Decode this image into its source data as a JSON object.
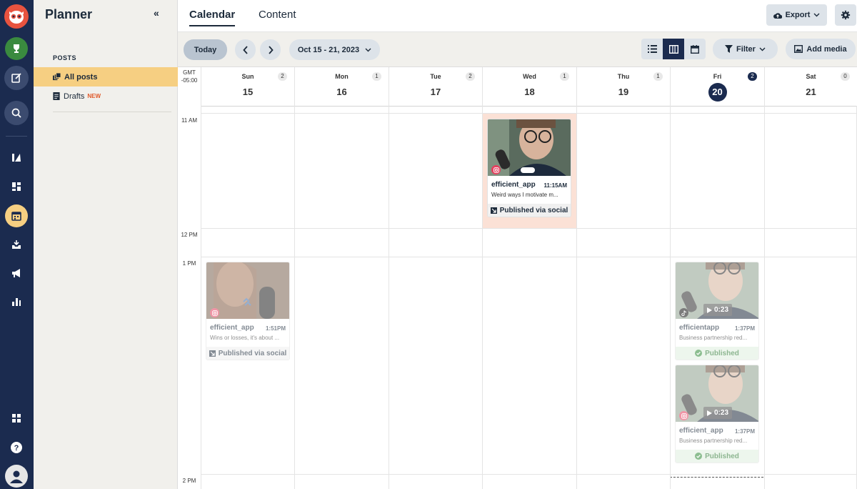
{
  "app": {
    "title": "Planner",
    "collapse_glyph": "«"
  },
  "rail": {
    "icons": [
      "owl-logo-icon",
      "trophy-icon",
      "compose-icon",
      "search-icon",
      "analytics-icon",
      "dashboard-icon",
      "calendar-icon",
      "inbox-icon",
      "megaphone-icon",
      "bar-chart-icon",
      "apps-icon",
      "help-icon",
      "profile-icon"
    ]
  },
  "panel": {
    "section": "POSTS",
    "items": [
      {
        "label": "All posts",
        "badge": ""
      },
      {
        "label": "Drafts",
        "badge": "NEW"
      }
    ]
  },
  "tabs": [
    {
      "label": "Calendar"
    },
    {
      "label": "Content"
    }
  ],
  "header_actions": {
    "export_label": "Export"
  },
  "toolbar": {
    "today_label": "Today",
    "date_range": "Oct 15 - 21, 2023",
    "filter_label": "Filter",
    "add_media_label": "Add media"
  },
  "calendar": {
    "timezone": "GMT\n-05:00",
    "days": [
      {
        "name": "Sun",
        "date": "15",
        "count": "2",
        "today": false
      },
      {
        "name": "Mon",
        "date": "16",
        "count": "1",
        "today": false
      },
      {
        "name": "Tue",
        "date": "17",
        "count": "2",
        "today": false
      },
      {
        "name": "Wed",
        "date": "18",
        "count": "1",
        "today": false
      },
      {
        "name": "Thu",
        "date": "19",
        "count": "1",
        "today": false
      },
      {
        "name": "Fri",
        "date": "20",
        "count": "2",
        "today": true
      },
      {
        "name": "Sat",
        "date": "21",
        "count": "0",
        "today": false
      }
    ],
    "times": [
      "11 AM",
      "12 PM",
      "1 PM",
      "2 PM"
    ]
  },
  "posts": [
    {
      "account": "efficient_app",
      "time": "11:15AM",
      "text": "Weird ways I motivate m...",
      "status": "Published via social",
      "network": "instagram-icon",
      "duration": ""
    },
    {
      "account": "efficient_app",
      "time": "1:51PM",
      "text": "Wins or losses, it's about ...",
      "status": "Published via social",
      "network": "instagram-icon",
      "duration": ""
    },
    {
      "account": "efficientapp",
      "time": "1:37PM",
      "text": "Business partnership red...",
      "status": "Published",
      "network": "tiktok-icon",
      "duration": "0:23"
    },
    {
      "account": "efficient_app",
      "time": "1:37PM",
      "text": "Business partnership red...",
      "status": "Published",
      "network": "instagram-icon",
      "duration": "0:23"
    }
  ],
  "colors": {
    "rail": "#1b2b4f",
    "panel": "#f1f0ec",
    "active_item": "#f6cf82",
    "highlight_slot": "#fbe1d6",
    "published_green": "#4fa35a"
  }
}
